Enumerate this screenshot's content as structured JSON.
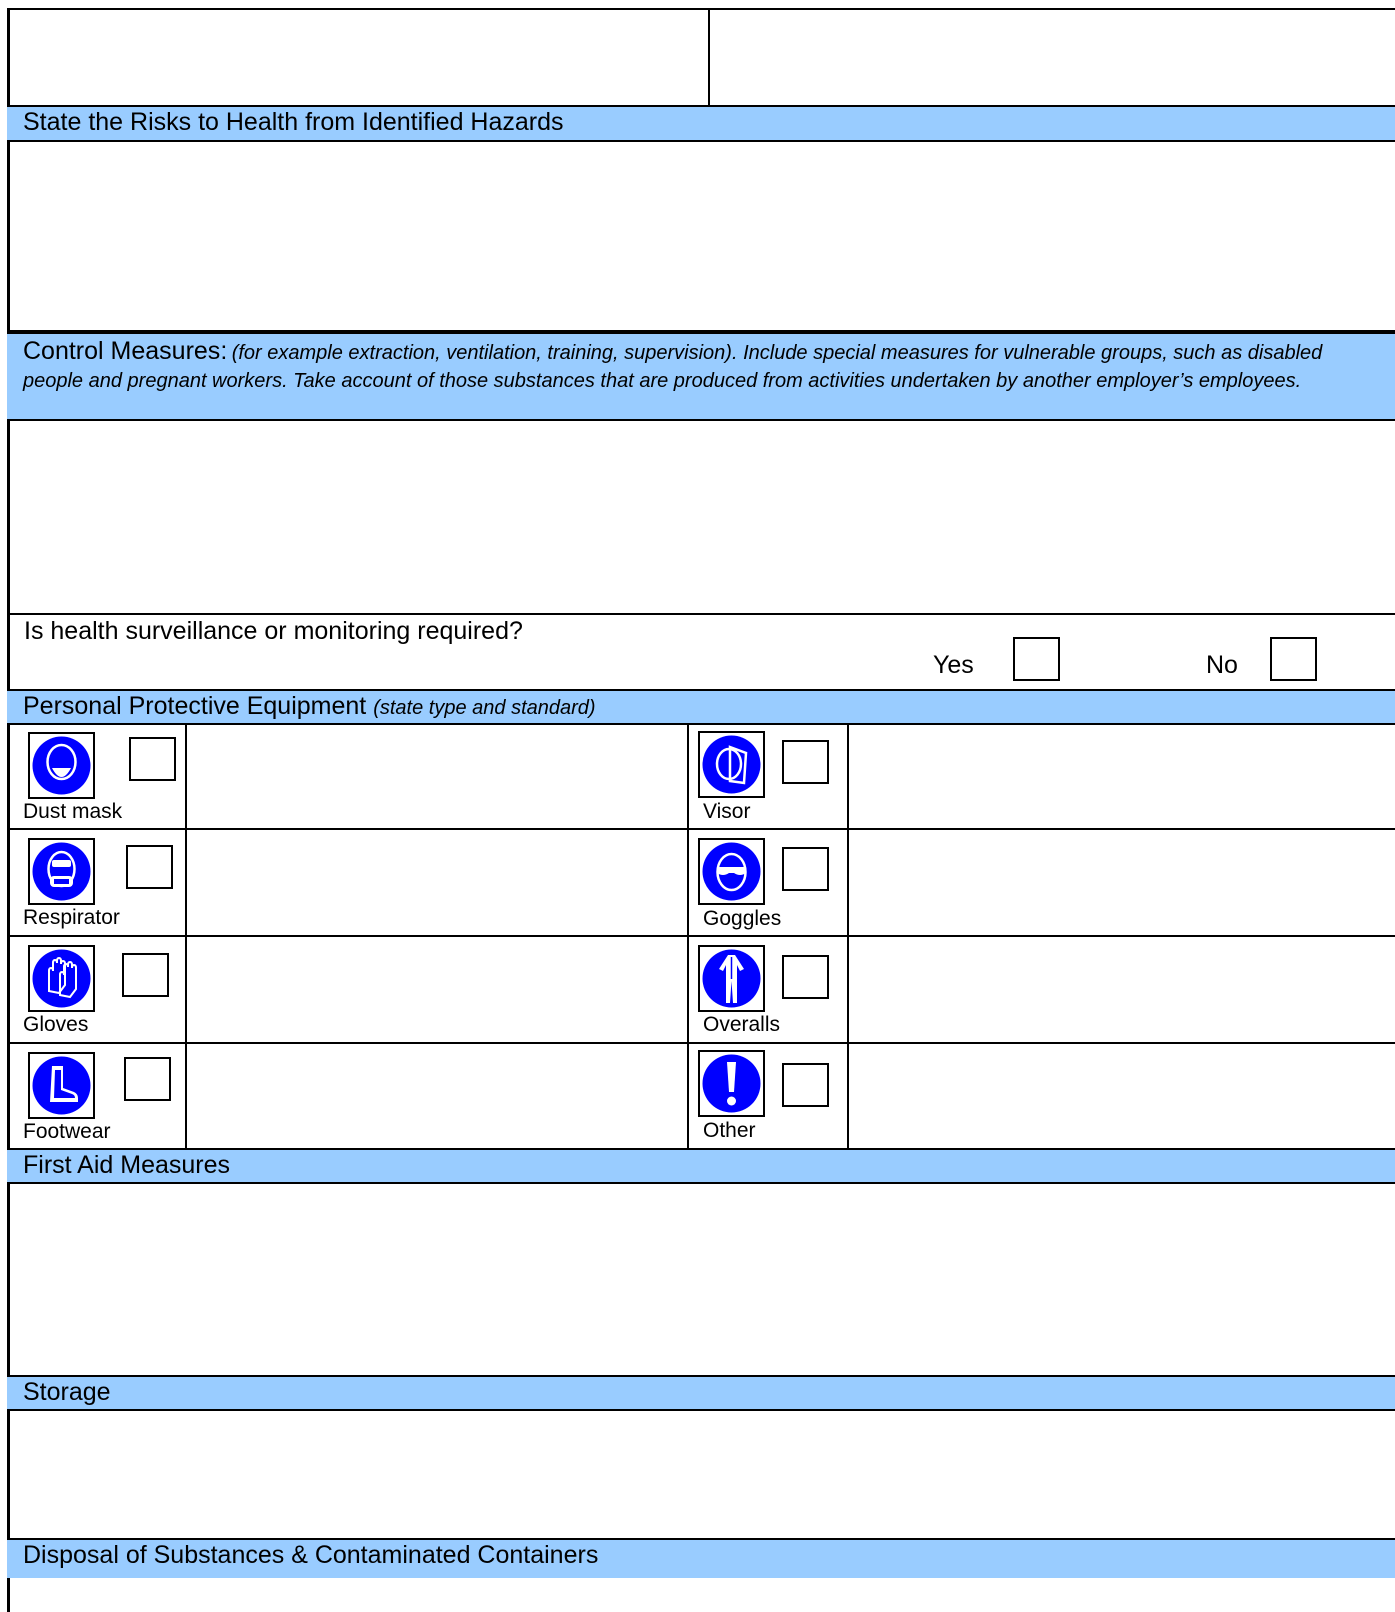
{
  "sections": {
    "risks": {
      "title": "State the Risks to Health from Identified Hazards"
    },
    "control": {
      "title": "Control Measures",
      "colon": ":",
      "description": "(for example extraction, ventilation, training, supervision).  Include special measures for vulnerable groups, such as disabled people and pregnant workers.  Take account of those substances that are produced from activities undertaken by another employer’s employees."
    },
    "surveillance": {
      "question": "Is health surveillance or monitoring required?",
      "yes_label": "Yes",
      "no_label": "No"
    },
    "ppe": {
      "title": "Personal Protective Equipment",
      "subtitle": "(state type and standard)",
      "items": {
        "dust_mask": "Dust mask",
        "visor": "Visor",
        "respirator": "Respirator",
        "goggles": "Goggles",
        "gloves": "Gloves",
        "overalls": "Overalls",
        "footwear": "Footwear",
        "other": "Other"
      }
    },
    "first_aid": {
      "title": "First Aid Measures"
    },
    "storage": {
      "title": "Storage"
    },
    "disposal": {
      "title": "Disposal of Substances & Contaminated Containers"
    }
  },
  "colors": {
    "band": "#99ccff",
    "icon_blue": "#0000ff",
    "border": "#000000"
  },
  "icons": [
    "dust-mask-icon",
    "visor-icon",
    "respirator-icon",
    "goggles-icon",
    "gloves-icon",
    "overalls-icon",
    "footwear-icon",
    "other-icon"
  ]
}
